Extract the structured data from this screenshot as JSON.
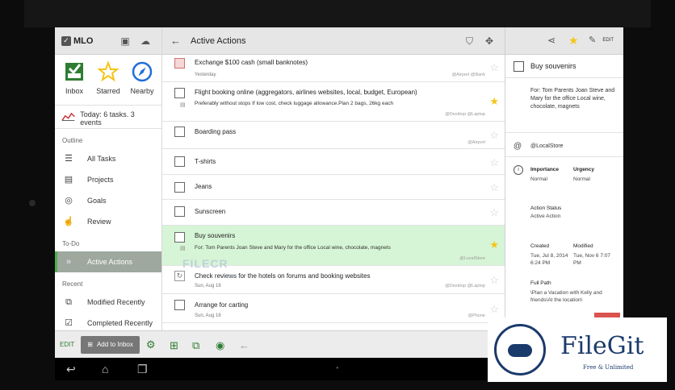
{
  "app": {
    "name": "MLO"
  },
  "sidebar": {
    "quick": [
      {
        "label": "Inbox",
        "icon": "inbox-icon"
      },
      {
        "label": "Starred",
        "icon": "star-icon"
      },
      {
        "label": "Nearby",
        "icon": "compass-icon"
      }
    ],
    "today_text": "Today: 6 tasks. 3 events",
    "outline_label": "Outline",
    "outline_items": [
      "All Tasks",
      "Projects",
      "Goals",
      "Review"
    ],
    "todo_label": "To-Do",
    "todo_items": [
      "Active Actions"
    ],
    "recent_label": "Recent",
    "recent_items": [
      "Modified Recently",
      "Completed Recently"
    ],
    "edit_label": "EDIT",
    "add_inbox_label": "Add to Inbox"
  },
  "list": {
    "title": "Active Actions",
    "rows": [
      {
        "title": "Exchange $100 cash (small banknotes)",
        "sub": "Yesterday",
        "note": "",
        "ctx": "@Airport  @Bank",
        "starred": false,
        "check": "red"
      },
      {
        "title": "Flight booking online (aggregators, airlines websites, local, budget, European)",
        "sub": "",
        "note": "Preferably without stops If low cost, check luggage allowance.Plan 2 bags, 26kg each",
        "ctx": "@Desktop  @Laptop",
        "starred": true,
        "check": "normal"
      },
      {
        "title": "Boarding pass",
        "sub": "",
        "note": "",
        "ctx": "@Airport",
        "starred": false,
        "check": "normal"
      },
      {
        "title": "T-shirts",
        "sub": "",
        "note": "",
        "ctx": "",
        "starred": false,
        "check": "normal"
      },
      {
        "title": "Jeans",
        "sub": "",
        "note": "",
        "ctx": "",
        "starred": false,
        "check": "normal"
      },
      {
        "title": "Sunscreen",
        "sub": "",
        "note": "",
        "ctx": "",
        "starred": false,
        "check": "normal"
      },
      {
        "title": "Buy souvenirs",
        "sub": "",
        "note": "For: Tom Parents Joan Steve and Mary for the office Local wine, chocolate, magnets",
        "ctx": "@LocalStore",
        "starred": true,
        "check": "normal"
      },
      {
        "title": "Check reviews for the hotels on forums and booking websites",
        "sub": "Sun, Aug 16",
        "note": "",
        "ctx": "@Desktop  @Laptop",
        "starred": false,
        "check": "repeat"
      },
      {
        "title": "Arrange for carting",
        "sub": "Sun, Aug 16",
        "note": "",
        "ctx": "@Phone",
        "starred": false,
        "check": "normal"
      }
    ]
  },
  "detail": {
    "edit_label": "EDIT",
    "title": "Buy souvenirs",
    "note": "For: Tom Parents Joan Steve and Mary for the office Local wine, chocolate, magnets",
    "context": "@LocalStore",
    "importance_label": "Importance",
    "importance_value": "Normal",
    "urgency_label": "Urgency",
    "urgency_value": "Normal",
    "status_label": "Action Status",
    "status_value": "Active Action",
    "created_label": "Created",
    "created_value": "Tue, Jul 8, 2014 6:24 PM",
    "modified_label": "Modified",
    "modified_value": "Tue, Nov 6 7:07 PM",
    "path_label": "Full Path",
    "path_value": "\\Plan a Vacation with Kelly and friends\\At the location\\"
  },
  "watermark": {
    "filecr": "FILECR",
    "filecr_sub": ".com",
    "filegit_name": "FileGit",
    "filegit_tag": "Free & Unlimited"
  },
  "colors": {
    "accent": "#4caf50",
    "star": "#f5c518",
    "selected_row": "#d6f5d6",
    "brand_blue": "#1a3a6b"
  }
}
